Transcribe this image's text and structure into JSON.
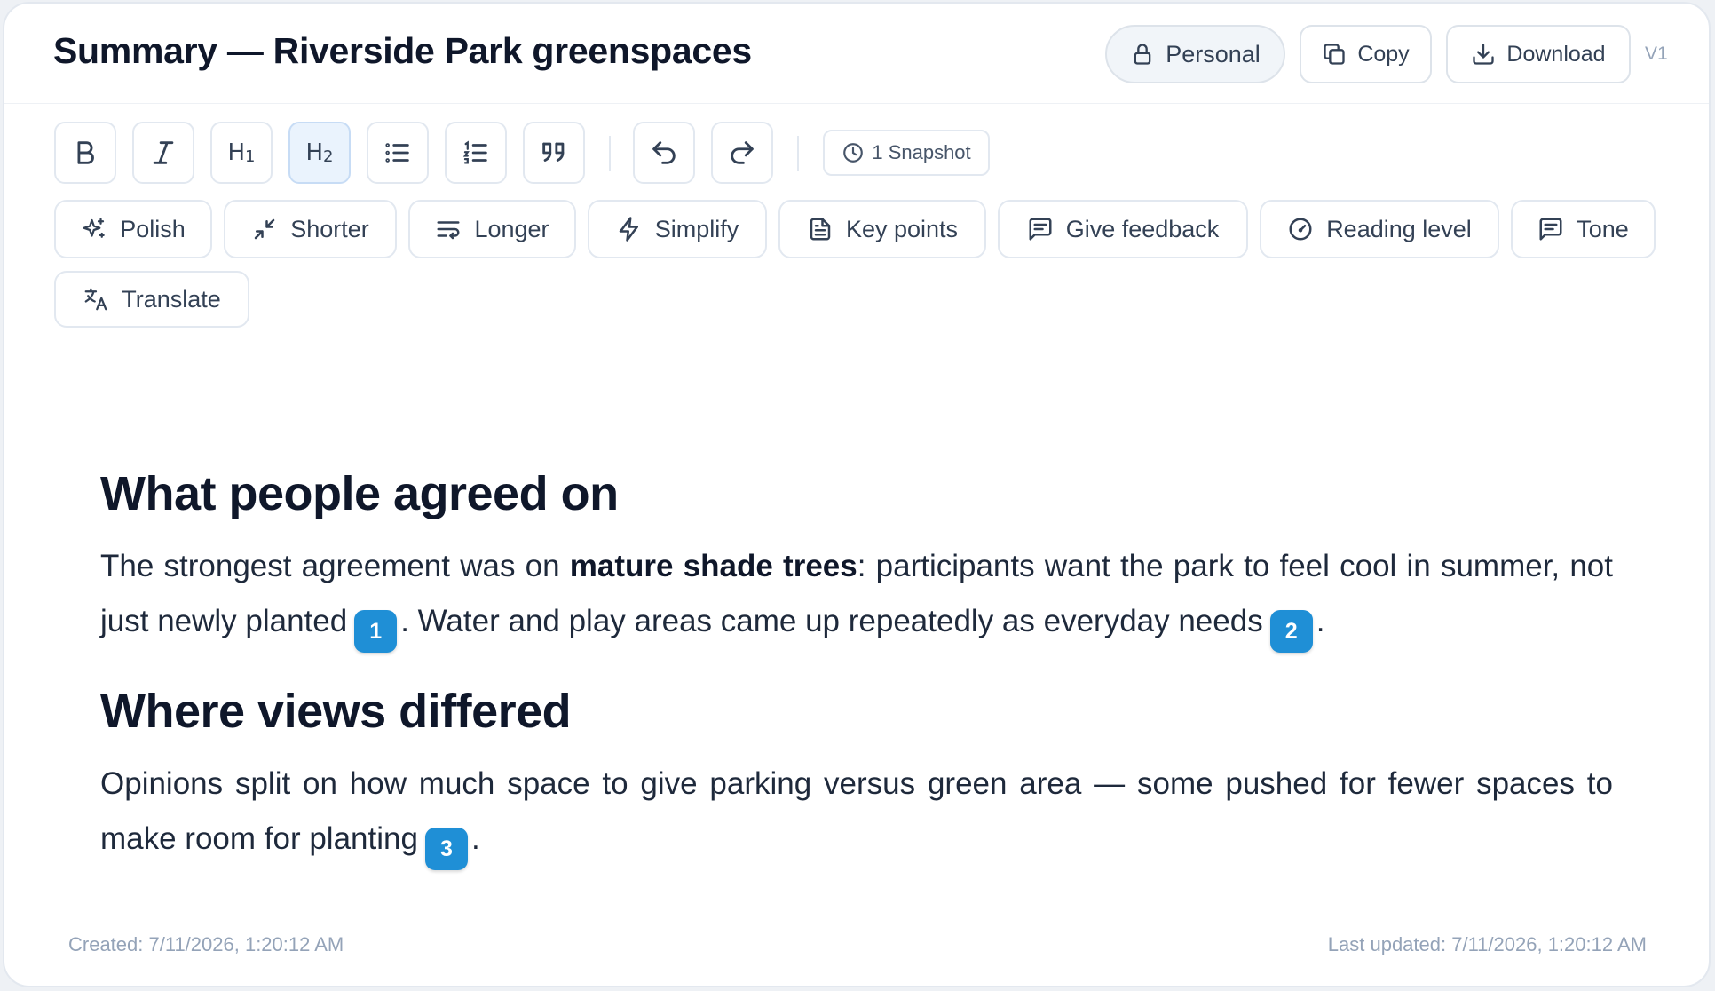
{
  "header": {
    "title": "Summary — Riverside Park greenspaces",
    "personal_label": "Personal",
    "copy_label": "Copy",
    "download_label": "Download",
    "version": "V1"
  },
  "toolbar": {
    "format": [
      {
        "name": "bold",
        "label": "B"
      },
      {
        "name": "italic",
        "label": "I"
      },
      {
        "name": "heading-1",
        "label": "H1"
      },
      {
        "name": "heading-2",
        "label": "H2",
        "active": true
      },
      {
        "name": "bullet-list",
        "label": ""
      },
      {
        "name": "numbered-list",
        "label": ""
      },
      {
        "name": "quote",
        "label": ""
      },
      {
        "name": "undo",
        "label": ""
      },
      {
        "name": "redo",
        "label": ""
      }
    ],
    "h1_main": "H",
    "h1_sub": "1",
    "h2_main": "H",
    "h2_sub": "2",
    "snapshot_label": "1 Snapshot"
  },
  "ai_actions": {
    "polish": "Polish",
    "shorter": "Shorter",
    "longer": "Longer",
    "simplify": "Simplify",
    "key_points": "Key points",
    "give_feedback": "Give feedback",
    "reading_level": "Reading level",
    "tone": "Tone",
    "translate": "Translate"
  },
  "document": {
    "section1_heading": "What people agreed on",
    "section1_p1_a": "The strongest agreement was on ",
    "section1_p1_bold": "mature shade trees",
    "section1_p1_b": ": participants want the park to feel cool in summer, not just newly planted",
    "section1_p1_cite1": "1",
    "section1_p1_c": ". Water and play areas came up repeatedly as everyday needs",
    "section1_p1_cite2": "2",
    "section1_p1_d": ".",
    "section2_heading": "Where views differed",
    "section2_p1_a": "Opinions split on how much space to give parking versus green area — some pushed for fewer spaces to make room for planting",
    "section2_p1_cite3": "3",
    "section2_p1_b": "."
  },
  "footer": {
    "created": "Created: 7/11/2026, 1:20:12 AM",
    "updated": "Last updated: 7/11/2026, 1:20:12 AM"
  },
  "colors": {
    "accent": "#1f8fd6",
    "active_button_bg": "#eaf3fd"
  }
}
